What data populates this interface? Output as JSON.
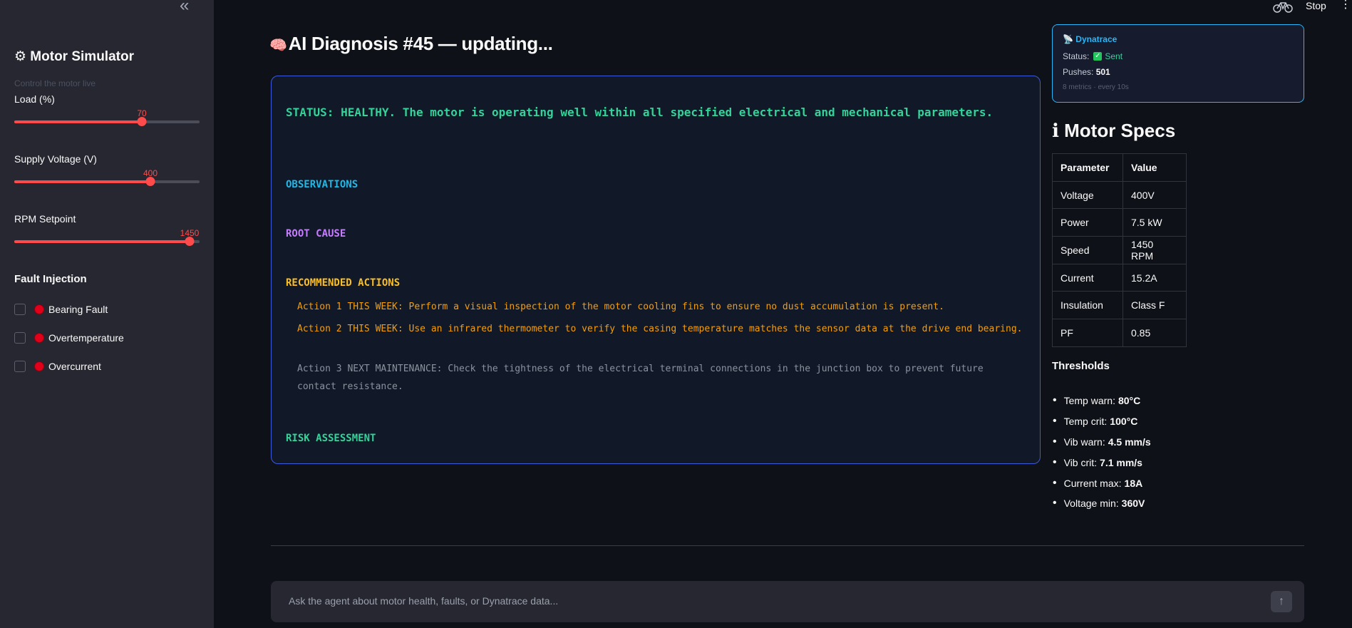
{
  "sidebar": {
    "collapse_icon": "«",
    "title": "⚙ Motor Simulator",
    "caption": "Control the motor live",
    "sliders": [
      {
        "label": "Load (%)",
        "value": "70",
        "fraction": 0.69
      },
      {
        "label": "Supply Voltage (V)",
        "value": "400",
        "fraction": 0.735
      },
      {
        "label": "RPM Setpoint",
        "value": "1450",
        "fraction": 0.945
      }
    ],
    "fault_title": "Fault Injection",
    "faults": [
      {
        "label": "Bearing Fault",
        "checked": false
      },
      {
        "label": "Overtemperature",
        "checked": false
      },
      {
        "label": "Overcurrent",
        "checked": false
      }
    ]
  },
  "topbar": {
    "running_icon": "bicycle-icon",
    "stop_label": "Stop",
    "menu_icon": "⋮"
  },
  "diagnosis": {
    "icon": "🧠",
    "title": "AI Diagnosis #45 — updating...",
    "status_line": "STATUS: HEALTHY. The motor is operating well within all specified electrical and mechanical parameters.",
    "observations_label": "OBSERVATIONS",
    "root_cause_label": "ROOT CAUSE",
    "recommended_label": "RECOMMENDED ACTIONS",
    "actions": [
      "Action 1 THIS WEEK: Perform a visual inspection of the motor cooling fins to ensure no dust accumulation is present.",
      "Action 2 THIS WEEK: Use an infrared thermometer to verify the casing temperature matches the sensor data at the drive end bearing.",
      "Action 3 NEXT MAINTENANCE: Check the tightness of the electrical terminal connections in the junction box to prevent future contact resistance."
    ],
    "risk_label": "RISK ASSESSMENT"
  },
  "dynatrace": {
    "icon": "📡",
    "name": "Dynatrace",
    "status_label": "Status:",
    "status_icon": "✓",
    "status_value": "Sent",
    "pushes_label": "Pushes:",
    "pushes_value": "501",
    "meta": "8 metrics · every 10s"
  },
  "specs": {
    "icon": "ℹ",
    "title": "Motor Specs",
    "headers": [
      "Parameter",
      "Value"
    ],
    "rows": [
      [
        "Voltage",
        "400V"
      ],
      [
        "Power",
        "7.5 kW"
      ],
      [
        "Speed",
        "1450 RPM"
      ],
      [
        "Current",
        "15.2A"
      ],
      [
        "Insulation",
        "Class F"
      ],
      [
        "PF",
        "0.85"
      ]
    ]
  },
  "thresholds": {
    "title": "Thresholds",
    "items": [
      {
        "label": "Temp warn:",
        "value": "80°C"
      },
      {
        "label": "Temp crit:",
        "value": "100°C"
      },
      {
        "label": "Vib warn:",
        "value": "4.5 mm/s"
      },
      {
        "label": "Vib crit:",
        "value": "7.1 mm/s"
      },
      {
        "label": "Current max:",
        "value": "18A"
      },
      {
        "label": "Voltage min:",
        "value": "360V"
      }
    ]
  },
  "chat": {
    "placeholder": "Ask the agent about motor health, faults, or Dynatrace data...",
    "send_icon": "↑"
  }
}
